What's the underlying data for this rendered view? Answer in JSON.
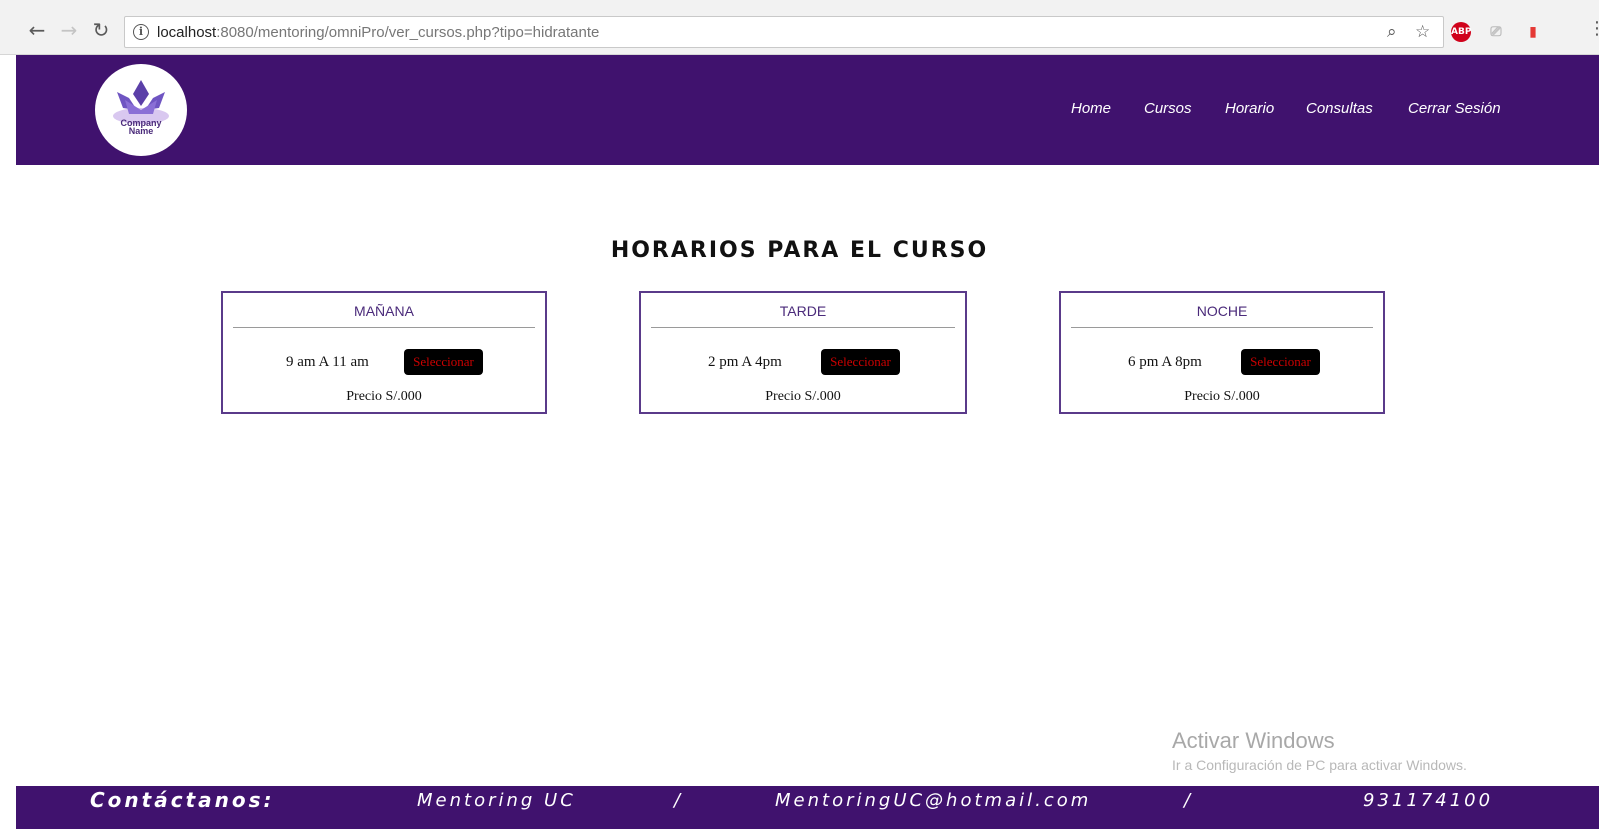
{
  "browser": {
    "url_host": "localhost",
    "url_rest": ":8080/mentoring/omniPro/ver_cursos.php?tipo=hidratante"
  },
  "logo": {
    "line1": "Company",
    "line2": "Name"
  },
  "nav": {
    "items": [
      "Home",
      "Cursos",
      "Horario",
      "Consultas",
      "Cerrar Sesión"
    ]
  },
  "page": {
    "heading": "HORARIOS PARA EL CURSO"
  },
  "schedules": [
    {
      "title": "MAÑANA",
      "time": "9 am A 11 am",
      "button": "Seleccionar",
      "price": "Precio S/.000"
    },
    {
      "title": "TARDE",
      "time": "2 pm A 4pm",
      "button": "Seleccionar",
      "price": "Precio S/.000"
    },
    {
      "title": "NOCHE",
      "time": "6 pm A 8pm",
      "button": "Seleccionar",
      "price": "Precio S/.000"
    }
  ],
  "watermark": {
    "title": "Activar Windows",
    "subtitle": "Ir a Configuración de PC para activar Windows."
  },
  "footer": {
    "contact_label": "Contáctanos:",
    "name": "Mentoring UC",
    "separator": "/",
    "email": "MentoringUC@hotmail.com",
    "phone": "931174100"
  },
  "colors": {
    "brand_purple": "#40126e",
    "button_text_red": "#cc0000"
  },
  "icons": {
    "back": "back-arrow-icon",
    "forward": "forward-arrow-icon",
    "reload": "reload-icon",
    "info": "info-icon",
    "zoom": "zoom-icon",
    "bookmark": "star-icon",
    "extension_abp": "adblock-icon",
    "extension_cast": "cast-icon",
    "extension_pdf": "pdf-icon"
  }
}
